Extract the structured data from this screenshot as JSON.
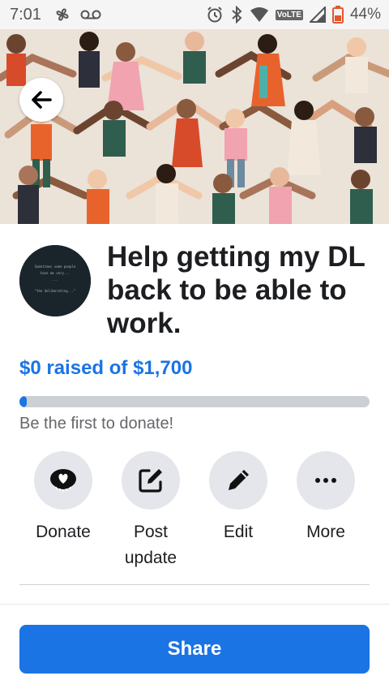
{
  "status_bar": {
    "time": "7:01",
    "network_label": "VoLTE",
    "battery": "44%"
  },
  "fundraiser": {
    "avatar_text": [
      "Sometimes some people",
      "have me very...",
      "...",
      "\"the deliberating...\""
    ],
    "title": "Help getting my DL back to be able to work.",
    "raised_text": "$0 raised of $1,700",
    "progress_fraction": 0.02,
    "subtext": "Be the first to donate!"
  },
  "actions": {
    "donate": "Donate",
    "post_update": "Post update",
    "edit": "Edit",
    "more": "More"
  },
  "share_label": "Share",
  "colors": {
    "accent": "#1b74e4",
    "secondary_text": "#65676b",
    "action_bg": "#e4e6eb"
  }
}
